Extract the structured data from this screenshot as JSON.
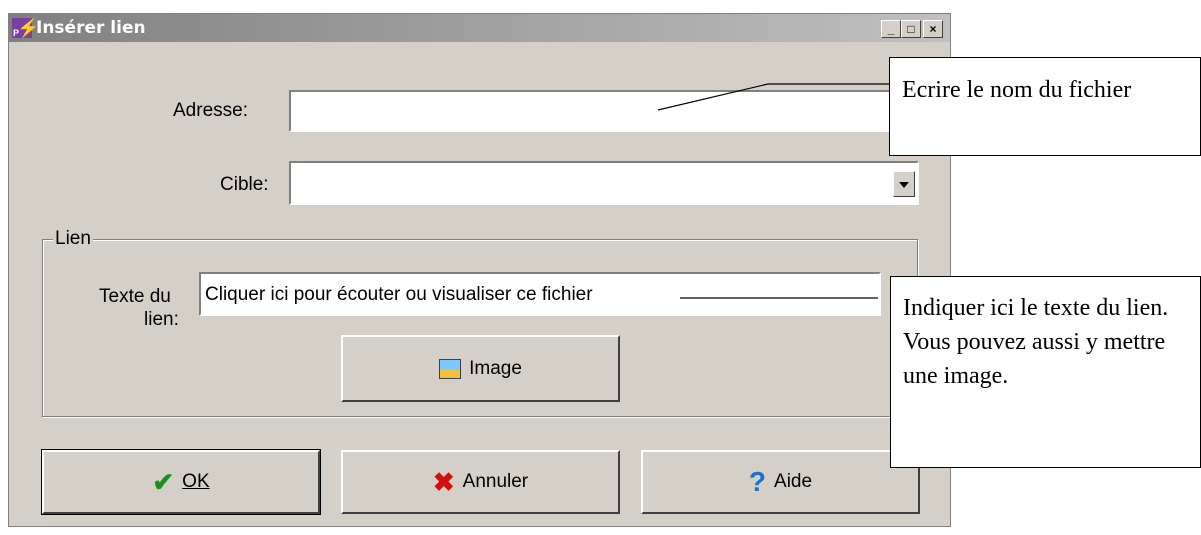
{
  "window": {
    "title": "Insérer lien",
    "minimize": "_",
    "maximize": "□",
    "close": "×"
  },
  "form": {
    "address_label": "Adresse:",
    "address_value": "",
    "target_label": "Cible:",
    "target_value": "",
    "group_label": "Lien",
    "link_text_label_1": "Texte du",
    "link_text_label_2": "lien:",
    "link_text_value": "Cliquer ici pour écouter ou visualiser ce fichier",
    "image_button": "Image"
  },
  "buttons": {
    "ok": "OK",
    "cancel": "Annuler",
    "help": "Aide"
  },
  "annotations": {
    "callout_1": "Ecrire le nom du fichier",
    "callout_2": "Indiquer ici le texte du lien. Vous pouvez aussi y mettre une image."
  },
  "colors": {
    "dialog_bg": "#d4d0c8",
    "ok_check": "#1e8f1e",
    "cancel_cross": "#d01010",
    "help_mark": "#1a6fd0"
  },
  "icons": [
    "app-icon",
    "image-icon",
    "check-icon",
    "cross-icon",
    "question-icon",
    "dropdown-arrow-icon"
  ]
}
